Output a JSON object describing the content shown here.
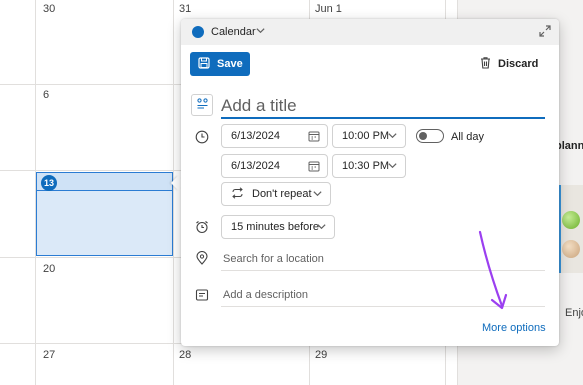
{
  "calendar": {
    "week_rows": [
      {
        "label": "week-1",
        "days": [
          "30",
          "31",
          "Jun 1"
        ]
      },
      {
        "label": "week-2",
        "days": [
          "6"
        ]
      },
      {
        "label": "week-3",
        "days": [
          "13"
        ]
      },
      {
        "label": "week-4",
        "days": [
          "20"
        ]
      },
      {
        "label": "week-5",
        "days": [
          "27",
          "28",
          "29"
        ]
      }
    ],
    "today": "13"
  },
  "dialog": {
    "calendar_name": "Calendar",
    "calendar_color": "#0f6cbd",
    "save_label": "Save",
    "discard_label": "Discard",
    "title_placeholder": "Add a title",
    "start_date": "6/13/2024",
    "start_time": "10:00 PM",
    "end_date": "6/13/2024",
    "end_time": "10:30 PM",
    "all_day_label": "All day",
    "all_day_on": false,
    "repeat": "Don't repeat",
    "reminder": "15 minutes before",
    "location_placeholder": "Search for a location",
    "description_placeholder": "Add a description",
    "more_options_label": "More options"
  },
  "side_panel": {
    "heading_fragment": "planne",
    "text_fragment": "Enjo"
  },
  "colors": {
    "accent": "#0f6cbd",
    "annotation_arrow": "#9b3ff0"
  },
  "icons": {
    "calendar_dot": "calendar-color-dot-icon",
    "expand": "expand-icon",
    "save": "save-icon",
    "discard": "trash-icon",
    "title": "event-type-icon",
    "time": "clock-icon",
    "date_picker": "calendar-icon",
    "repeat": "repeat-icon",
    "reminder": "alarm-icon",
    "location": "location-pin-icon",
    "description": "description-icon"
  }
}
